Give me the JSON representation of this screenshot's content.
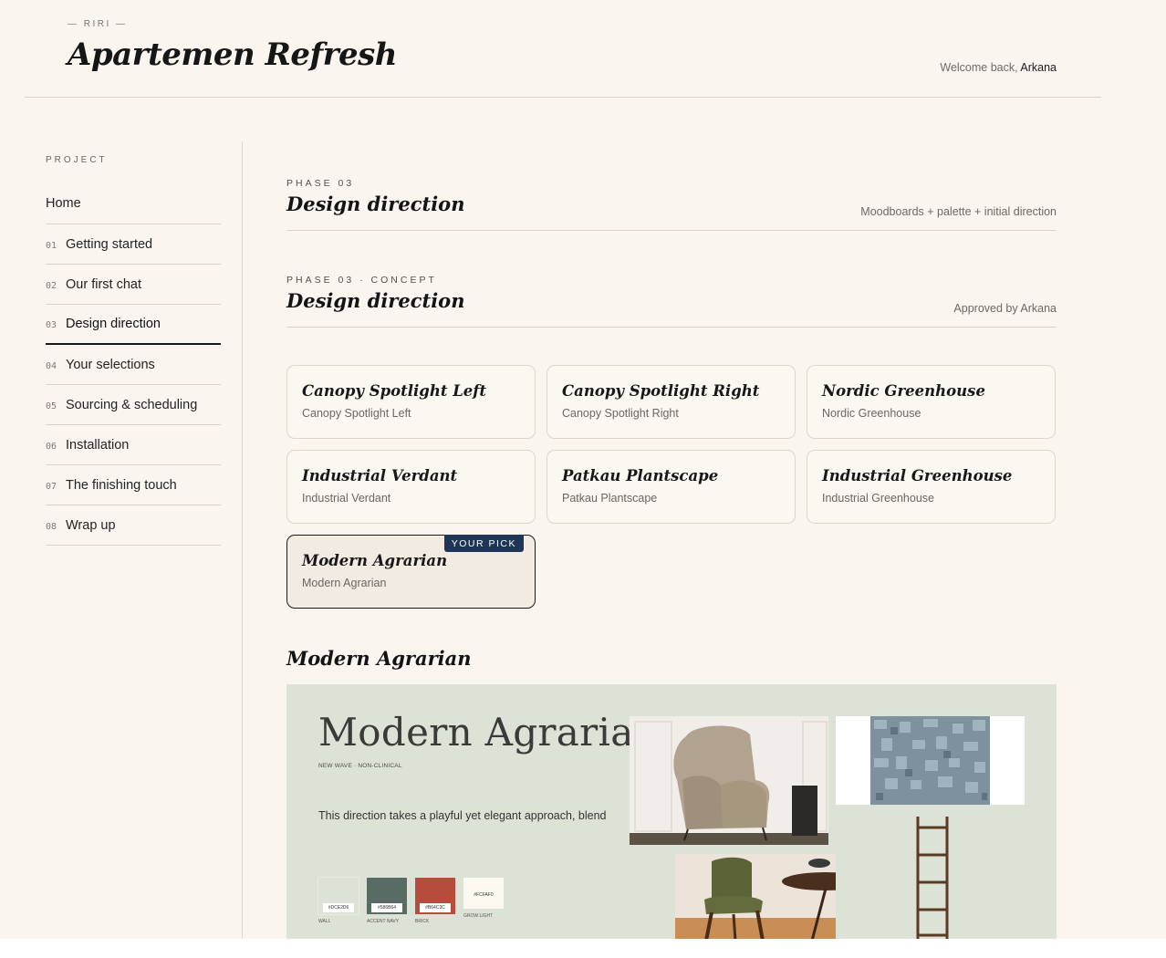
{
  "header": {
    "brand_kicker": "— RIRI —",
    "title": "Apartemen Refresh",
    "welcome_prefix": "Welcome back, ",
    "user_name": "Arkana"
  },
  "sidebar": {
    "heading": "PROJECT",
    "home_label": "Home",
    "items": [
      {
        "num": "01",
        "label": "Getting started"
      },
      {
        "num": "02",
        "label": "Our first chat"
      },
      {
        "num": "03",
        "label": "Design direction",
        "active": true
      },
      {
        "num": "04",
        "label": "Your selections"
      },
      {
        "num": "05",
        "label": "Sourcing & scheduling"
      },
      {
        "num": "06",
        "label": "Installation"
      },
      {
        "num": "07",
        "label": "The finishing touch"
      },
      {
        "num": "08",
        "label": "Wrap up"
      }
    ]
  },
  "phase": {
    "kicker": "PHASE 03",
    "title": "Design direction",
    "meta": "Moodboards + palette + initial direction"
  },
  "concept": {
    "kicker": "PHASE 03 · CONCEPT",
    "title": "Design direction",
    "meta": "Approved by Arkana"
  },
  "options": [
    {
      "title": "Canopy Spotlight Left",
      "subtitle": "Canopy Spotlight Left"
    },
    {
      "title": "Canopy Spotlight Right",
      "subtitle": "Canopy Spotlight Right"
    },
    {
      "title": "Nordic Greenhouse",
      "subtitle": "Nordic Greenhouse"
    },
    {
      "title": "Industrial Verdant",
      "subtitle": "Industrial Verdant"
    },
    {
      "title": "Patkau Plantscape",
      "subtitle": "Patkau Plantscape"
    },
    {
      "title": "Industrial Greenhouse",
      "subtitle": "Industrial Greenhouse"
    },
    {
      "title": "Modern Agrarian",
      "subtitle": "Modern Agrarian",
      "badge": "YOUR PICK"
    }
  ],
  "detail": {
    "title": "Modern Agrarian",
    "board_title": "Modern Agrarian",
    "board_tag": "NEW WAVE · NON-CLINICAL",
    "description": "This direction takes a playful yet elegant approach, blend",
    "swatches": [
      {
        "hex": "#DCE2D6",
        "label": "WALL",
        "color": "#dce2d6"
      },
      {
        "hex": "#586B64",
        "label": "ACCENT NAVY",
        "color": "#586b64"
      },
      {
        "hex": "#B64C3C",
        "label": "BRICK",
        "color": "#b64c3c"
      },
      {
        "hex": "#FCFAF0",
        "label": "GROW LIGHT",
        "color": "#fcfaf0"
      }
    ]
  },
  "colors": {
    "background": "#faf6ef",
    "badge": "#1d3557",
    "board": "#dde2d7"
  }
}
